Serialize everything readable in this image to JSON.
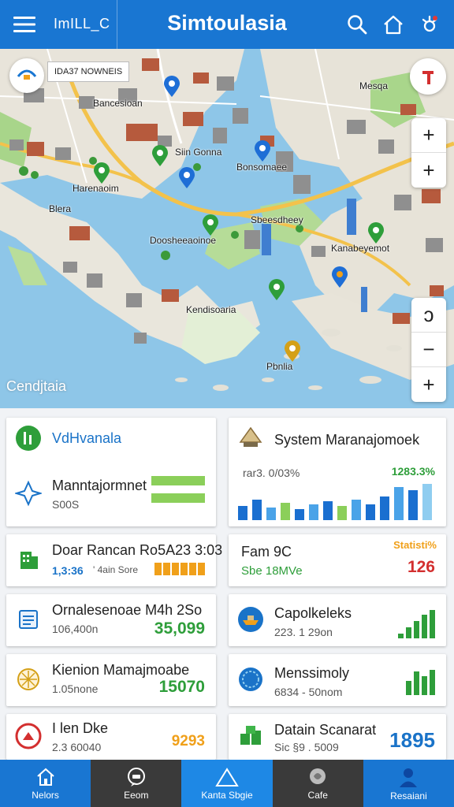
{
  "header": {
    "menu_icon": "hamburger-icon",
    "left_label": "ImILL_C",
    "title": "Simtoulasia",
    "actions": [
      "search-icon",
      "home-icon",
      "settings-icon"
    ]
  },
  "map": {
    "status_text": "IDA37 NOWNEIS",
    "labels": [
      "Bancesioan",
      "Siin Gonna",
      "Bonsomaee",
      "Harenaoim",
      "Blera",
      "Doosheeaoinoe",
      "Sbeesdheey",
      "Kanabeyemot",
      "Mesqa",
      "Kendisoaria",
      "Pbnlia",
      "Cendjtaia"
    ],
    "zoom_top": [
      "+",
      "+"
    ],
    "zoom_bottom": [
      "ↄ",
      "−",
      "+"
    ]
  },
  "cards": {
    "panel1": {
      "title": "VdHvanala",
      "line1": "Manntajormnet",
      "line2": "S00S"
    },
    "panel2": {
      "title": "System Maranajomoek",
      "left_stat": "rar3. 0/03%",
      "right_stat": "1283.3%"
    },
    "rows": [
      {
        "t1": "Doar Rancan Ro5A23 3:03",
        "t2a": "1,3:36",
        "t2b": "' 4ain Sore",
        "value": ""
      },
      {
        "t1": "Fam 9C",
        "t2a": "Sbe 18MVe",
        "t2b": "",
        "value": "126",
        "value_label": "Statisti%"
      },
      {
        "t1": "Ornalesenoae  M4h 2So",
        "t2a": "106,400n",
        "t2b": "",
        "value": "35,099"
      },
      {
        "t1": "Capolkeleks",
        "t2a": "223. 1 29on",
        "t2b": "",
        "value": ""
      },
      {
        "t1": "Kienion Mamajmoabe",
        "t2a": "1.05none",
        "t2b": "",
        "value": "15070"
      },
      {
        "t1": "Menssimoly",
        "t2a": "6834 - 50nom",
        "t2b": "",
        "value": ""
      },
      {
        "t1": "I len Dke",
        "t2a": "2.3 60040",
        "t2b": "",
        "value": "9293"
      },
      {
        "t1": "Datain Scanarat",
        "t2a": "Sic §9 . 5009",
        "t2b": "",
        "value": "1895"
      }
    ]
  },
  "nav": [
    {
      "label": "Nelors",
      "icon": "home-icon"
    },
    {
      "label": "Eeom",
      "icon": "chat-icon"
    },
    {
      "label": "Kanta Sbgie",
      "icon": "triangle-icon"
    },
    {
      "label": "Cafe",
      "icon": "globe-icon"
    },
    {
      "label": "Resaiani",
      "icon": "user-icon"
    }
  ],
  "colors": {
    "primary": "#1976d2",
    "green": "#2e9e3a",
    "orange": "#f0a01a",
    "red": "#d32f2f",
    "blue_value": "#1a73c8"
  }
}
